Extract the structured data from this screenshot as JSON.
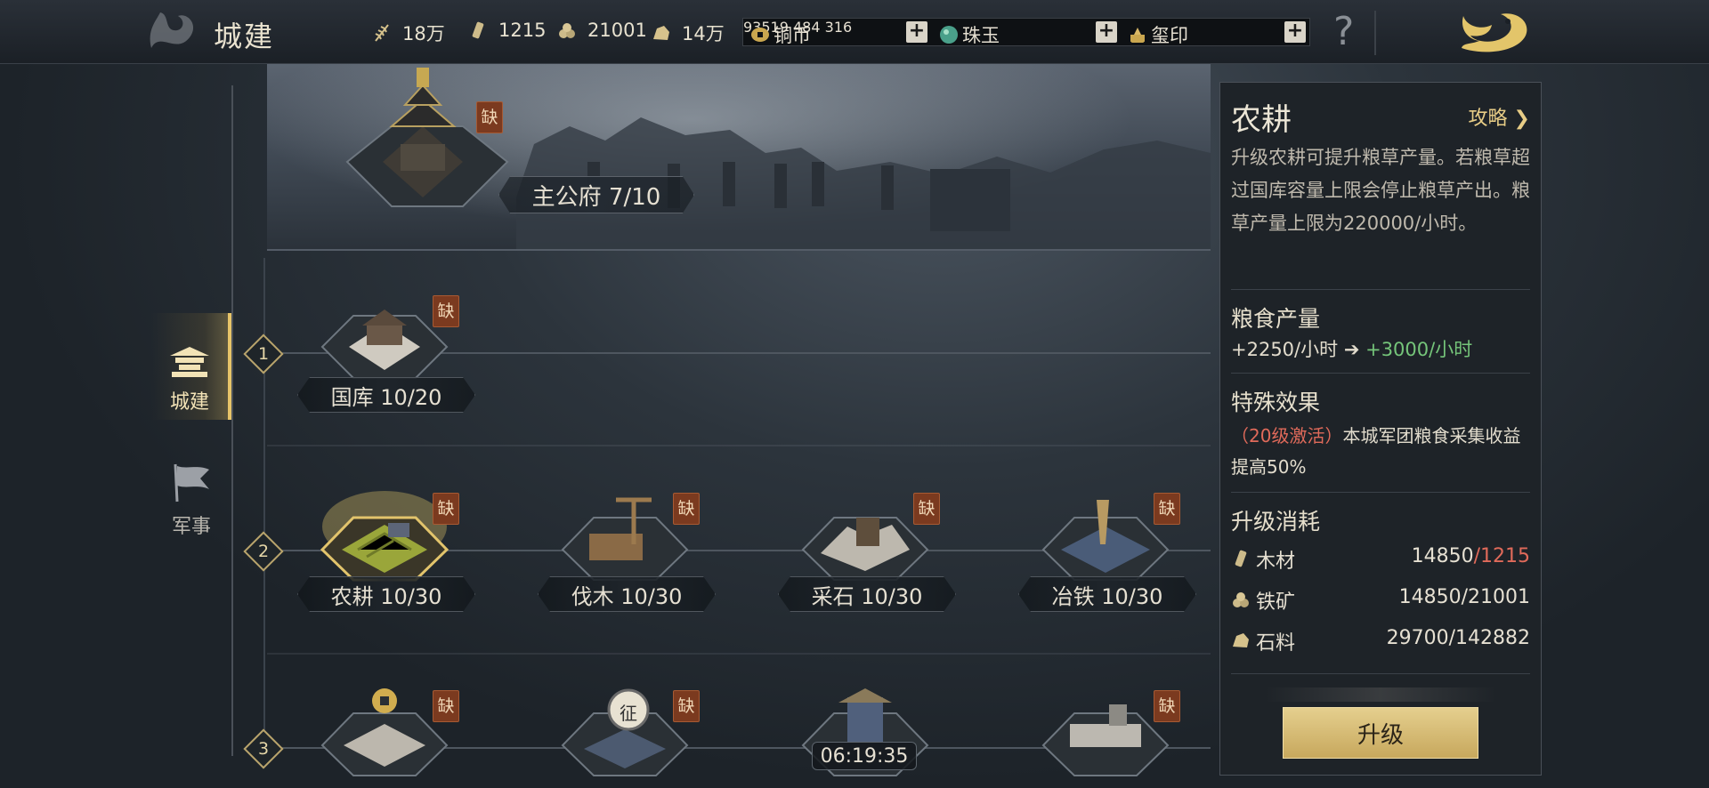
{
  "header": {
    "title": "城建",
    "resources": [
      {
        "icon": "grain-icon",
        "value": "18万"
      },
      {
        "icon": "wood-icon",
        "value": "1215"
      },
      {
        "icon": "iron-icon",
        "value": "21001"
      },
      {
        "icon": "stone-icon",
        "value": "14万"
      }
    ],
    "currencies": [
      {
        "icon": "copper-coin-icon",
        "label": "铜币",
        "value": "93519"
      },
      {
        "icon": "jade-icon",
        "label": "珠玉",
        "value": "484"
      },
      {
        "icon": "seal-icon",
        "label": "玺印",
        "value": "316"
      }
    ],
    "plus": "+",
    "help": "?"
  },
  "nav": {
    "items": [
      {
        "label": "城建",
        "icon": "city-build-icon",
        "active": true
      },
      {
        "label": "军事",
        "icon": "military-flag-icon",
        "active": false
      }
    ]
  },
  "main_building": {
    "label": "主公府 7/10",
    "lack": "缺"
  },
  "tiers": [
    {
      "number": "1",
      "buildings": [
        {
          "label": "国库 10/20",
          "lack": "缺"
        }
      ]
    },
    {
      "number": "2",
      "buildings": [
        {
          "label": "农耕 10/30",
          "lack": "缺"
        },
        {
          "label": "伐木 10/30",
          "lack": "缺"
        },
        {
          "label": "采石 10/30",
          "lack": "缺"
        },
        {
          "label": "冶铁 10/30",
          "lack": "缺"
        }
      ]
    },
    {
      "number": "3",
      "buildings": [
        {
          "label": "",
          "lack": "缺"
        },
        {
          "label": "",
          "lack": "缺",
          "badge": "征"
        },
        {
          "label": "",
          "timer": "06:19:35"
        },
        {
          "label": "",
          "lack": "缺"
        }
      ]
    }
  ],
  "detail": {
    "title": "农耕",
    "guide": "攻略",
    "description": "升级农耕可提升粮草产量。若粮草超过国库容量上限会停止粮草产出。粮草产量上限为220000/小时。",
    "production_heading": "粮食产量",
    "production_current": "+2250/小时",
    "production_next": "+3000/小时",
    "special_heading": "特殊效果",
    "special_condition": "（20级激活）",
    "special_text": "本城军团粮食采集收益提高50%",
    "cost_heading": "升级消耗",
    "costs": [
      {
        "icon": "wood-icon",
        "name": "木材",
        "required": "14850",
        "owned": "/1215",
        "insufficient": true
      },
      {
        "icon": "iron-icon",
        "name": "铁矿",
        "required": "14850",
        "owned": "/21001",
        "insufficient": false
      },
      {
        "icon": "stone-icon",
        "name": "石料",
        "required": "29700",
        "owned": "/142882",
        "insufficient": false
      }
    ],
    "upgrade_button": "升级"
  },
  "colors": {
    "accent_gold": "#e7c469",
    "lack_badge": "#7b3a1f",
    "increase_green": "#75c57a",
    "insufficient_red": "#e06a5a"
  }
}
